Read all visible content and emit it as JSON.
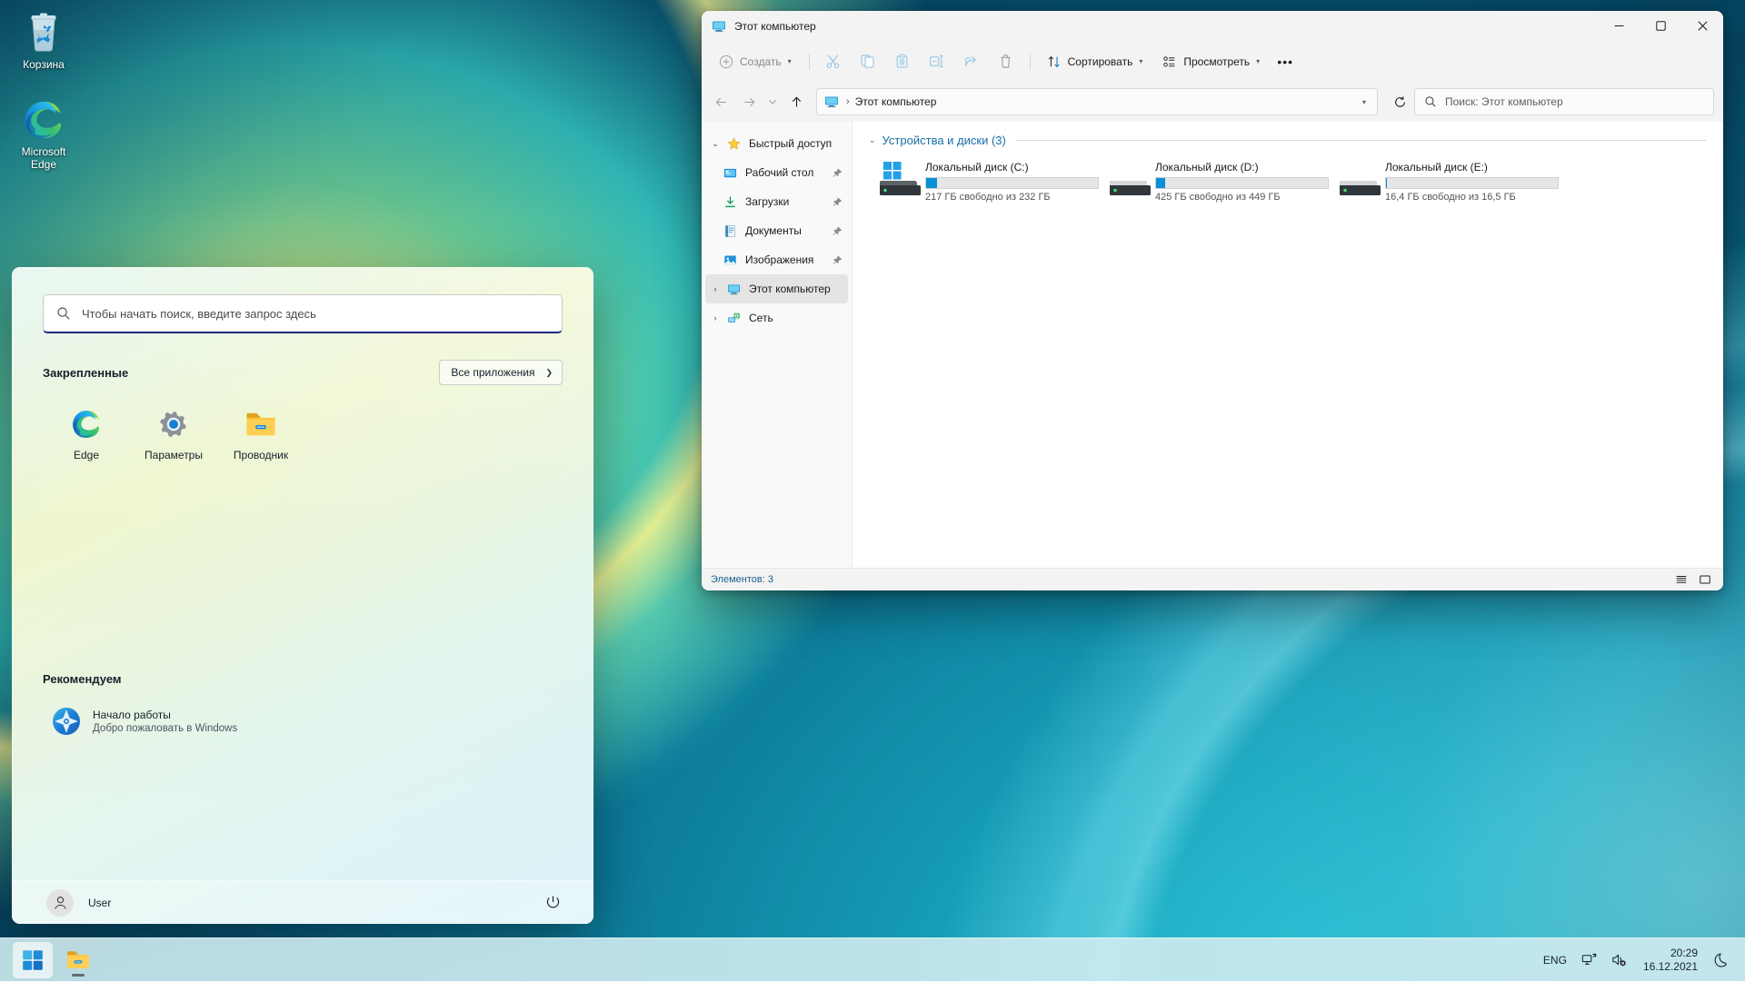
{
  "desktop": {
    "icons": [
      {
        "name": "recycle-bin",
        "label": "Корзина"
      },
      {
        "name": "microsoft-edge",
        "label": "Microsoft\nEdge",
        "line1": "Microsoft",
        "line2": "Edge"
      }
    ]
  },
  "explorer": {
    "title": "Этот компьютер",
    "window_controls": {
      "minimize": "Свернуть",
      "maximize": "Развернуть",
      "close": "Закрыть"
    },
    "commandbar": {
      "new_label": "Создать",
      "icons": [
        {
          "name": "cut-icon",
          "title": "Вырезать"
        },
        {
          "name": "copy-icon",
          "title": "Копировать"
        },
        {
          "name": "paste-icon",
          "title": "Вставить"
        },
        {
          "name": "rename-icon",
          "title": "Переименовать"
        },
        {
          "name": "share-icon",
          "title": "Поделиться"
        },
        {
          "name": "delete-icon",
          "title": "Удалить"
        }
      ],
      "sort_label": "Сортировать",
      "view_label": "Просмотреть",
      "more_label": "•••"
    },
    "nav": {
      "back": "Назад",
      "forward": "Вперед",
      "recent": "Последние расположения",
      "up": "Вверх",
      "refresh": "Обновить",
      "breadcrumb": "Этот компьютер",
      "search_placeholder": "Поиск: Этот компьютер"
    },
    "sidebar": {
      "items": [
        {
          "label": "Быстрый доступ",
          "icon": "star-icon",
          "twisty": "expanded",
          "pinned": false,
          "selected": false,
          "child": false
        },
        {
          "label": "Рабочий стол",
          "icon": "desktop-icon",
          "twisty": "none",
          "pinned": true,
          "selected": false,
          "child": true
        },
        {
          "label": "Загрузки",
          "icon": "downloads-icon",
          "twisty": "none",
          "pinned": true,
          "selected": false,
          "child": true
        },
        {
          "label": "Документы",
          "icon": "documents-icon",
          "twisty": "none",
          "pinned": true,
          "selected": false,
          "child": true
        },
        {
          "label": "Изображения",
          "icon": "pictures-icon",
          "twisty": "none",
          "pinned": true,
          "selected": false,
          "child": true
        },
        {
          "label": "Этот компьютер",
          "icon": "this-pc-icon",
          "twisty": "collapsed",
          "pinned": false,
          "selected": true,
          "child": false
        },
        {
          "label": "Сеть",
          "icon": "network-icon",
          "twisty": "collapsed",
          "pinned": false,
          "selected": false,
          "child": false
        }
      ]
    },
    "group": {
      "header": "Устройства и диски (3)"
    },
    "drives": [
      {
        "name": "Локальный диск (C:)",
        "sub": "217 ГБ свободно из 232 ГБ",
        "used_pct": 6.5,
        "icon": "windows-drive-icon"
      },
      {
        "name": "Локальный диск (D:)",
        "sub": "425 ГБ свободно из 449 ГБ",
        "used_pct": 5.3,
        "icon": "drive-icon"
      },
      {
        "name": "Локальный диск (E:)",
        "sub": "16,4 ГБ свободно из 16,5 ГБ",
        "used_pct": 0.6,
        "icon": "drive-icon"
      }
    ],
    "status": {
      "items_label": "Элементов: 3",
      "details_view": "Таблица",
      "large_icons_view": "Крупные значки"
    }
  },
  "start": {
    "search": {
      "placeholder": "Чтобы начать поиск, введите запрос здесь",
      "icon": "search-icon"
    },
    "pinned": {
      "header": "Закрепленные",
      "all_apps_label": "Все приложения",
      "apps": [
        {
          "label": "Edge",
          "icon": "edge-icon"
        },
        {
          "label": "Параметры",
          "icon": "settings-gear-icon"
        },
        {
          "label": "Проводник",
          "icon": "file-explorer-icon"
        }
      ]
    },
    "recommended": {
      "header": "Рекомендуем",
      "items": [
        {
          "title": "Начало работы",
          "subtitle": "Добро пожаловать в Windows",
          "icon": "get-started-icon"
        }
      ]
    },
    "footer": {
      "user": "User",
      "power_label": "Завершение работы"
    }
  },
  "taskbar": {
    "start_label": "Пуск",
    "apps": [
      {
        "name": "start-button",
        "icon": "windows-logo-icon",
        "active": true
      },
      {
        "name": "file-explorer-taskbar",
        "icon": "file-explorer-icon",
        "running": true
      }
    ],
    "tray": {
      "language": "ENG",
      "network_title": "Сеть",
      "volume_title": "Звук отключен",
      "time": "20:29",
      "date": "16.12.2021",
      "notifications_title": "Уведомления"
    }
  },
  "colors": {
    "accent": "#0a8fd8",
    "link": "#1b6ea8",
    "close_hover": "#c42b1c"
  }
}
